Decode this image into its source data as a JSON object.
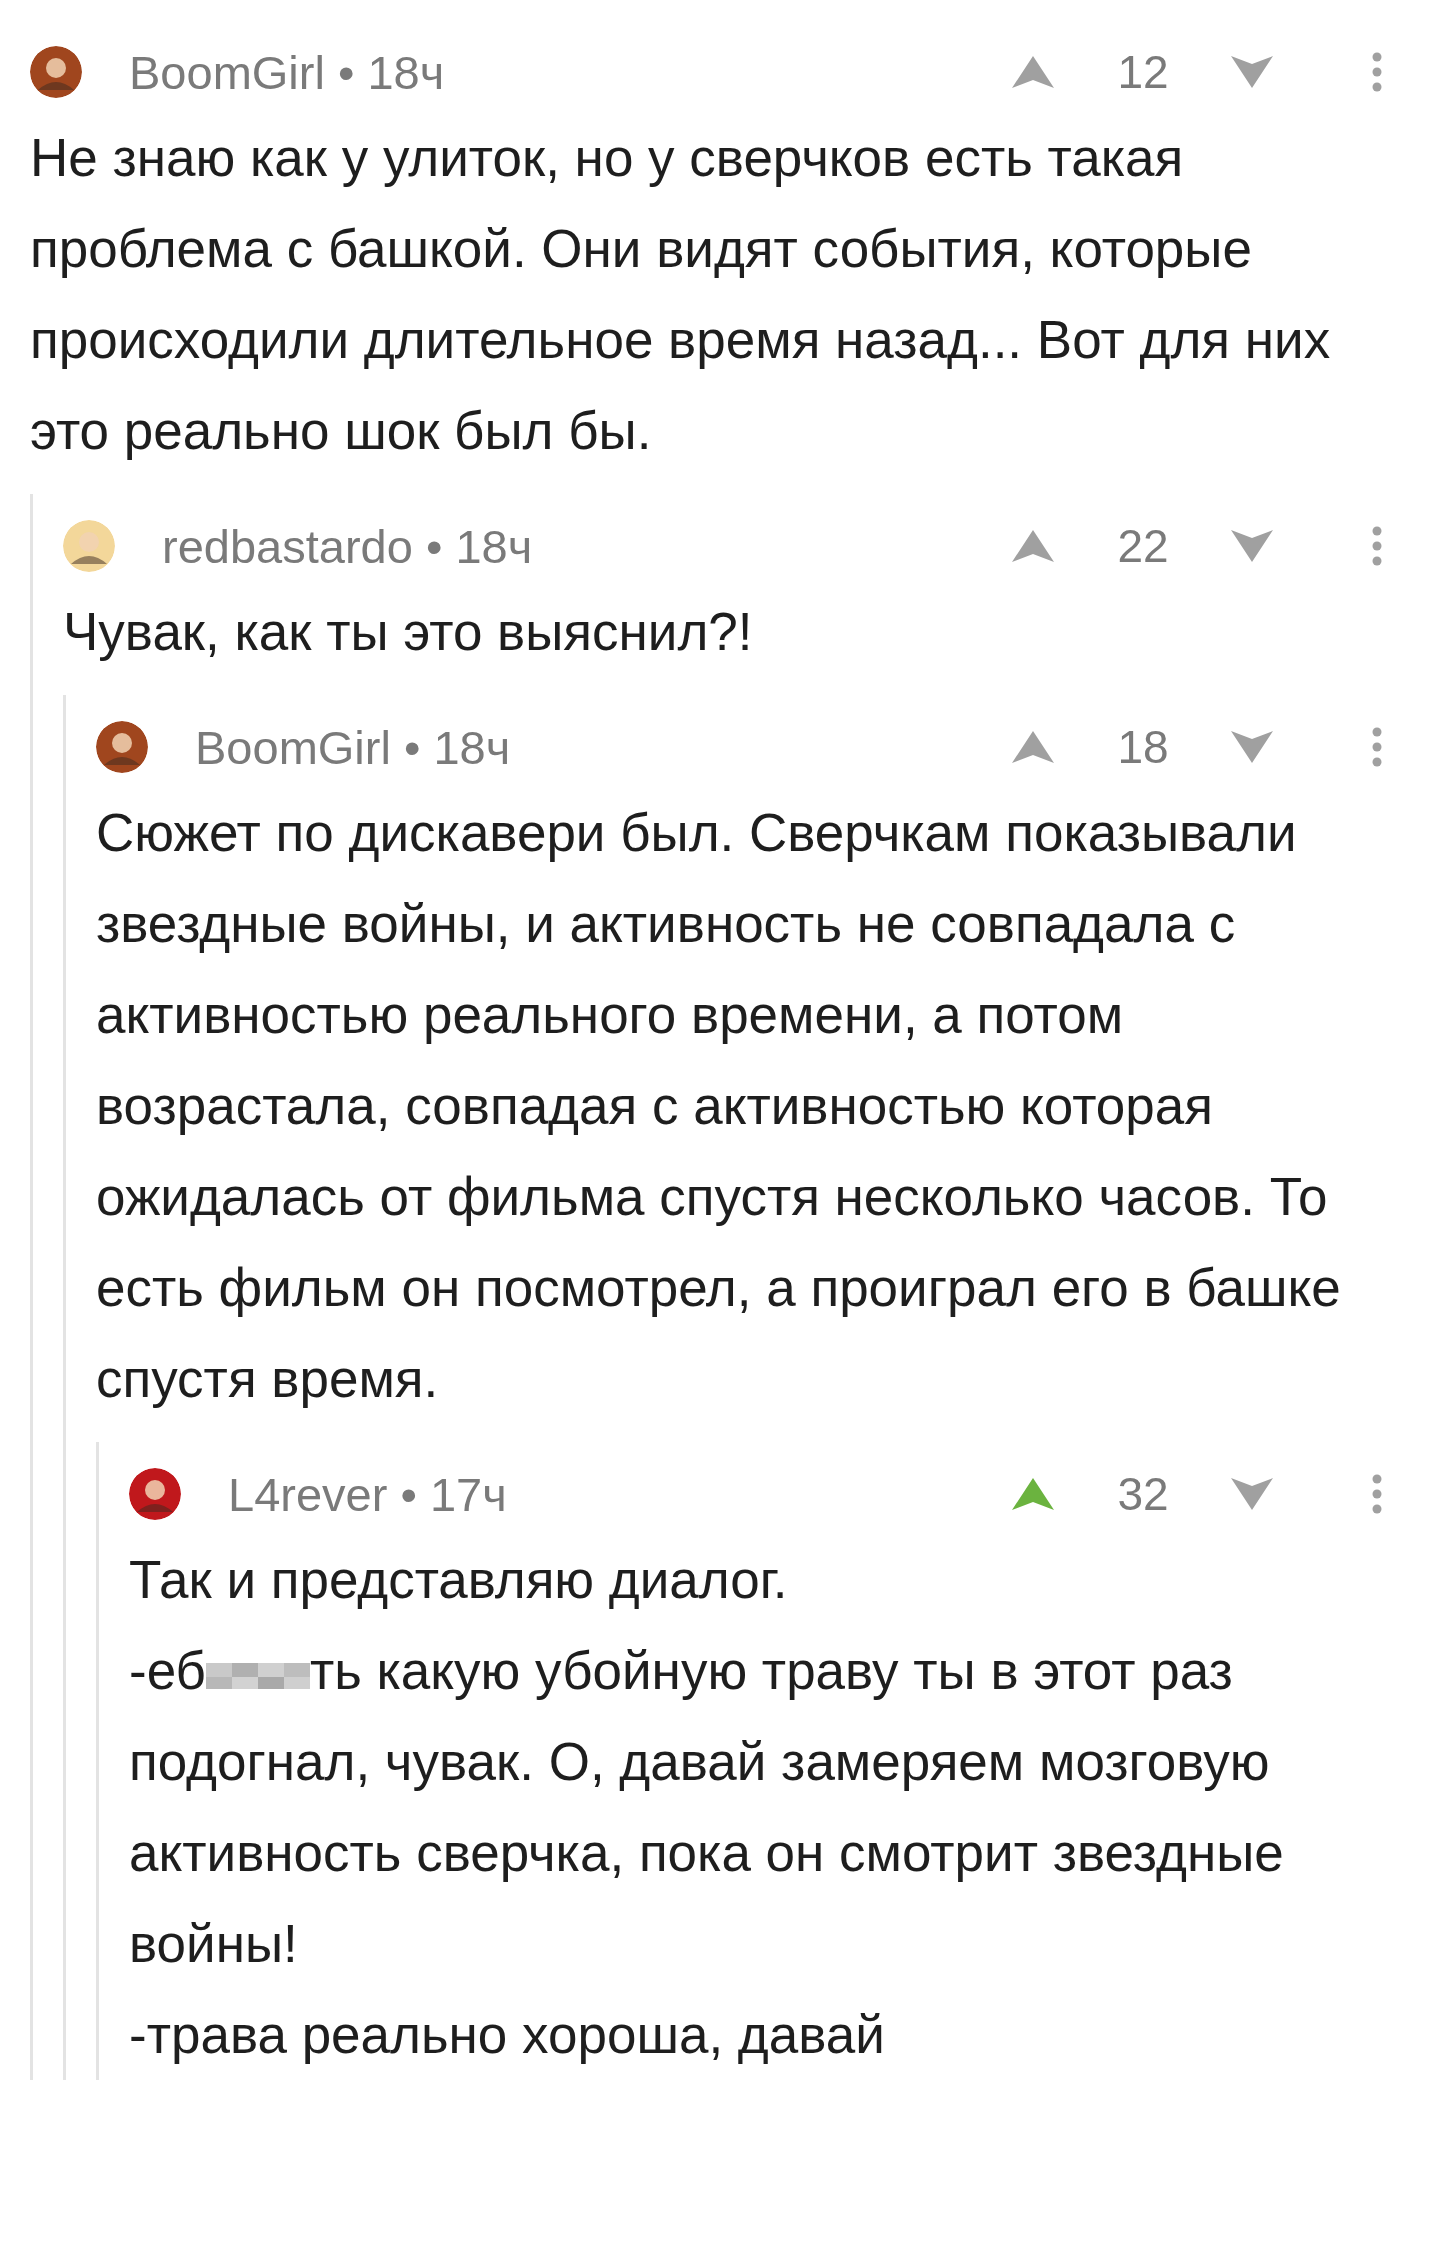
{
  "separator": "•",
  "comments": [
    {
      "author": "BoomGirl",
      "time": "18ч",
      "avatar": {
        "color": "#a0461e"
      },
      "score": "12",
      "upvoted": false,
      "body": [
        [
          {
            "text": "Не знаю как у улиток, но у сверчков есть такая проблема с башкой. Они видят события, которые происходили длительное время назад... Вот для них это реально шок был бы."
          }
        ]
      ],
      "children": [
        {
          "author": "redbastardo",
          "time": "18ч",
          "avatar": {
            "color": "#f3d79a"
          },
          "score": "22",
          "upvoted": false,
          "body": [
            [
              {
                "text": "Чувак, как ты это выяснил?!"
              }
            ]
          ],
          "children": [
            {
              "author": "BoomGirl",
              "time": "18ч",
              "avatar": {
                "color": "#a0461e"
              },
              "score": "18",
              "upvoted": false,
              "body": [
                [
                  {
                    "text": "Сюжет по дискавери был. Сверчкам показывали звездные войны, и активность не совпадала с активностью реального времени, а потом возрастала, совпадая с активностью которая ожидалась от фильма спустя несколько часов. То есть фильм он посмотрел, а проиграл его в башке спустя время."
                  }
                ]
              ],
              "children": [
                {
                  "author": "L4rever",
                  "time": "17ч",
                  "avatar": {
                    "color": "#c0181c"
                  },
                  "score": "32",
                  "upvoted": true,
                  "body": [
                    [
                      {
                        "text": "Так и представляю диалог."
                      }
                    ],
                    [
                      {
                        "text": "-еб"
                      },
                      {
                        "kind": "blur"
                      },
                      {
                        "text": "ть какую убойную траву ты в этот раз подогнал, чувак. О, давай замеряем мозговую активность сверчка, пока он смотрит звездные войны!"
                      }
                    ],
                    [
                      {
                        "text": "-трава реально хороша, давай"
                      }
                    ]
                  ]
                }
              ]
            }
          ]
        }
      ]
    }
  ]
}
